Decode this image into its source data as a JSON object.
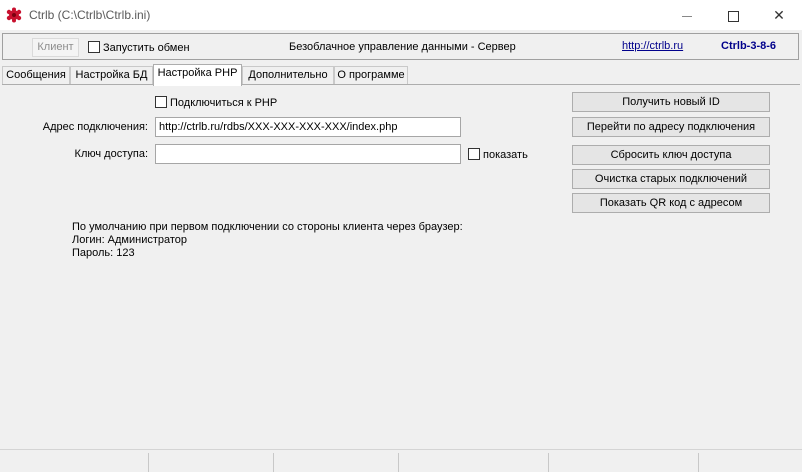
{
  "window": {
    "title": "Ctrlb (C:\\Ctrlb\\Ctrlb.ini)",
    "app_icon": "ctrlb-logo-icon",
    "minimize_icon": "minimize-icon",
    "maximize_icon": "maximize-icon",
    "close_icon": "close-icon",
    "close_glyph": "✕"
  },
  "toolbar": {
    "client_label": "Клиент",
    "start_exchange_label": "Запустить обмен",
    "start_exchange_checked": false,
    "title": "Безоблачное управление данными - Сервер",
    "link": "http://ctrlb.ru",
    "version": "Ctrlb-3-8-6"
  },
  "tabs": [
    {
      "label": "Сообщения",
      "active": false
    },
    {
      "label": "Настройка БД",
      "active": false
    },
    {
      "label": "Настройка PHP",
      "active": true
    },
    {
      "label": "Дополнительно",
      "active": false
    },
    {
      "label": "О программе",
      "active": false
    }
  ],
  "php": {
    "connect_label": "Подключиться к PHP",
    "connect_checked": false,
    "address_label": "Адрес подключения:",
    "address_value": "http://ctrlb.ru/rdbs/XXX-XXX-XXX-XXX/index.php",
    "key_label": "Ключ доступа:",
    "key_value": "",
    "show_label": "показать",
    "show_checked": false
  },
  "buttons": {
    "new_id": "Получить новый ID",
    "goto_address": "Перейти по адресу подключения",
    "reset_key": "Сбросить ключ доступа",
    "clean_old": "Очистка старых подключений",
    "show_qr": "Показать QR код с адресом"
  },
  "info": {
    "line1": "По умолчанию при первом подключении со стороны клиента через браузер:",
    "line2": "Логин: Администратор",
    "line3": "Пароль: 123"
  },
  "colors": {
    "link": "#00008b",
    "window_bg": "#f0f0f0"
  }
}
